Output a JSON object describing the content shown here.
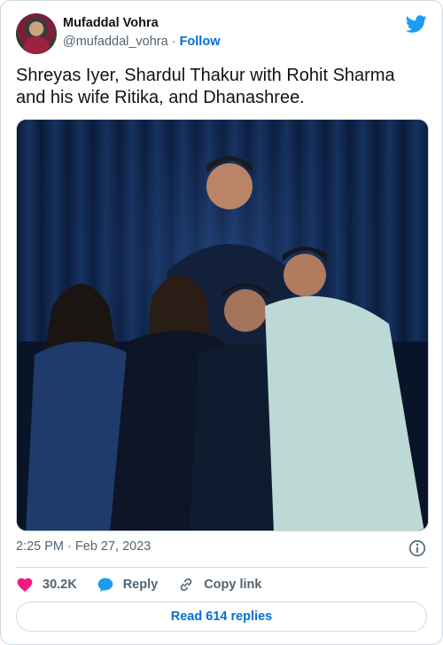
{
  "author": {
    "name": "Mufaddal Vohra",
    "handle": "@mufaddal_vohra",
    "separator": "·",
    "follow_label": "Follow"
  },
  "tweet": {
    "text": "Shreyas Iyer, Shardul Thakur with Rohit Sharma and his wife Ritika, and Dhanashree."
  },
  "meta": {
    "time": "2:25 PM",
    "separator": "·",
    "date": "Feb 27, 2023"
  },
  "actions": {
    "likes": "30.2K",
    "reply_label": "Reply",
    "copy_link_label": "Copy link"
  },
  "footer": {
    "read_replies_label": "Read 614 replies"
  },
  "colors": {
    "accent": "#006fd6",
    "like": "#f91880",
    "reply": "#1d9bf0",
    "twitter_blue": "#1d9bf0",
    "muted": "#536471",
    "border": "#cfd9de"
  },
  "icons": [
    "twitter-bird-icon",
    "info-icon",
    "heart-icon",
    "reply-bubble-icon",
    "link-icon"
  ]
}
